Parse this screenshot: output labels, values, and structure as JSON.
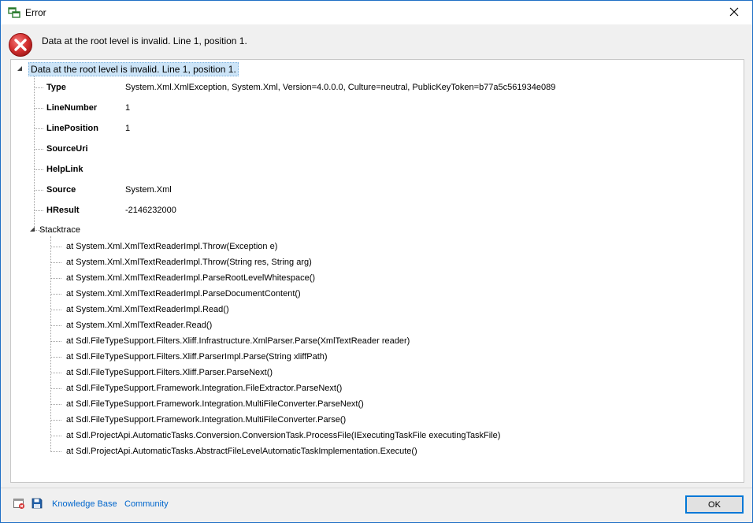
{
  "window": {
    "title": "Error",
    "header_message": "Data at the root level is invalid. Line 1, position 1."
  },
  "tree": {
    "root_label": "Data at the root level is invalid. Line 1, position 1.",
    "properties": [
      {
        "name": "Type",
        "value": "System.Xml.XmlException, System.Xml, Version=4.0.0.0, Culture=neutral, PublicKeyToken=b77a5c561934e089"
      },
      {
        "name": "LineNumber",
        "value": "1"
      },
      {
        "name": "LinePosition",
        "value": "1"
      },
      {
        "name": "SourceUri",
        "value": ""
      },
      {
        "name": "HelpLink",
        "value": ""
      },
      {
        "name": "Source",
        "value": "System.Xml"
      },
      {
        "name": "HResult",
        "value": "-2146232000"
      }
    ],
    "stacktrace_label": "Stacktrace",
    "stacktrace": [
      "at System.Xml.XmlTextReaderImpl.Throw(Exception e)",
      "at System.Xml.XmlTextReaderImpl.Throw(String res, String arg)",
      "at System.Xml.XmlTextReaderImpl.ParseRootLevelWhitespace()",
      "at System.Xml.XmlTextReaderImpl.ParseDocumentContent()",
      "at System.Xml.XmlTextReaderImpl.Read()",
      "at System.Xml.XmlTextReader.Read()",
      "at Sdl.FileTypeSupport.Filters.Xliff.Infrastructure.XmlParser.Parse(XmlTextReader reader)",
      "at Sdl.FileTypeSupport.Filters.Xliff.ParserImpl.Parse(String xliffPath)",
      "at Sdl.FileTypeSupport.Filters.Xliff.Parser.ParseNext()",
      "at Sdl.FileTypeSupport.Framework.Integration.FileExtractor.ParseNext()",
      "at Sdl.FileTypeSupport.Framework.Integration.MultiFileConverter.ParseNext()",
      "at Sdl.FileTypeSupport.Framework.Integration.MultiFileConverter.Parse()",
      "at Sdl.ProjectApi.AutomaticTasks.Conversion.ConversionTask.ProcessFile(IExecutingTaskFile executingTaskFile)",
      "at Sdl.ProjectApi.AutomaticTasks.AbstractFileLevelAutomaticTaskImplementation.Execute()"
    ]
  },
  "footer": {
    "knowledge_base_label": "Knowledge Base",
    "community_label": "Community",
    "ok_label": "OK"
  },
  "colors": {
    "accent": "#0078d7",
    "link": "#0066cc",
    "error_red": "#d32f2f",
    "selection": "#cce4f7"
  },
  "icons": {
    "app": "app-window-icon",
    "close": "close-icon",
    "error": "error-icon",
    "expander": "tree-expander-icon",
    "copy": "copy-report-icon",
    "save": "save-icon"
  }
}
